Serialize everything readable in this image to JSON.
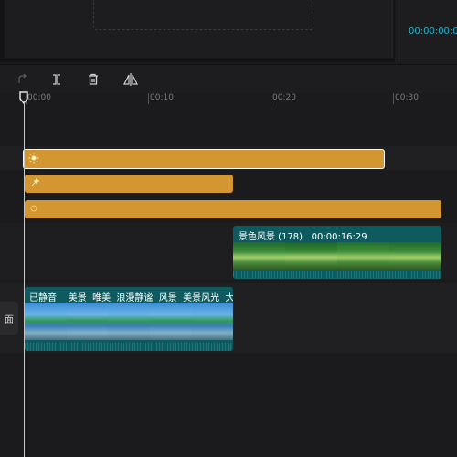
{
  "preview": {
    "timecode": "00:00:00:00"
  },
  "toolbar": {
    "icons": [
      "redo-icon",
      "split-icon",
      "delete-icon",
      "mirror-icon"
    ]
  },
  "ruler": {
    "ticks": [
      "00:00",
      "00:10",
      "00:20",
      "00:30"
    ]
  },
  "tracks": {
    "text_clips": [
      {
        "icon": "sun-effect-icon"
      },
      {
        "icon": "sparkle-effect-icon"
      },
      {
        "icon": "blank-effect-icon"
      }
    ],
    "video_clip_top": {
      "title": "景色风景 (178)",
      "duration": "00:00:16:29"
    },
    "video_clip_main": {
      "labels": [
        "已静音",
        "美景",
        "唯美",
        "浪漫静谧",
        "风景",
        "美景风光",
        "大海"
      ]
    }
  },
  "side_tab": {
    "label": "面"
  },
  "colors": {
    "accent_cyan": "#27b1c8",
    "clip_orange": "#d39630",
    "clip_teal": "#0f5a5e"
  }
}
